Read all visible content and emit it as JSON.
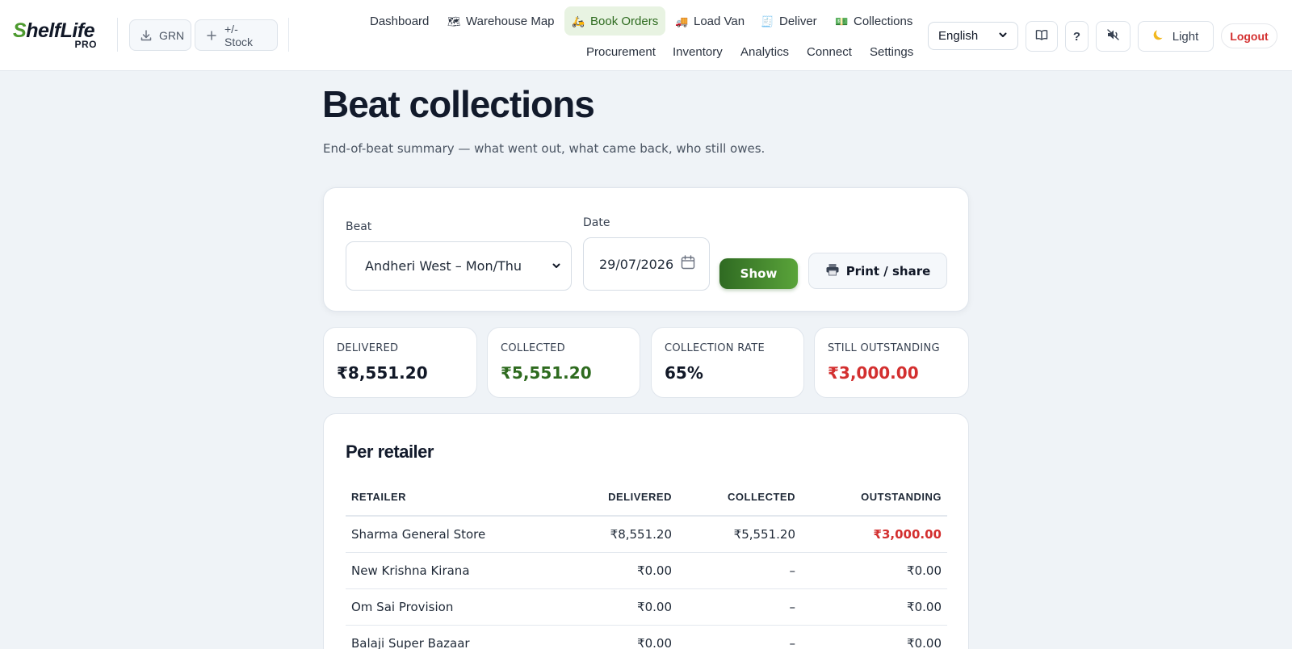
{
  "header": {
    "logo": {
      "brand_text": "ShelfLife",
      "brand_initial": "S",
      "brand_rest": "helfLife",
      "tagline": "PRO"
    },
    "quick_actions": [
      {
        "label": "GRN",
        "icon": "download-icon"
      },
      {
        "label": "+/- Stock",
        "icon": "plus-icon"
      }
    ],
    "nav_primary": [
      {
        "label": "Dashboard",
        "icon": ""
      },
      {
        "label": "Warehouse Map",
        "icon": "🗺"
      },
      {
        "label": "Book Orders",
        "icon": "🛵",
        "active": true
      },
      {
        "label": "Load Van",
        "icon": "🚚"
      },
      {
        "label": "Deliver",
        "icon": "🧾"
      },
      {
        "label": "Collections",
        "icon": "💵"
      }
    ],
    "nav_secondary": [
      {
        "label": "Procurement"
      },
      {
        "label": "Inventory"
      },
      {
        "label": "Analytics"
      },
      {
        "label": "Connect"
      },
      {
        "label": "Settings"
      }
    ],
    "language": {
      "selected": "English"
    },
    "help_label": "?",
    "theme_label": "Light",
    "logout_label": "Logout"
  },
  "page": {
    "title": "Beat collections",
    "subtitle": "End-of-beat summary — what went out, what came back, who still owes."
  },
  "filters": {
    "beat_label": "Beat",
    "beat_value": "Andheri West – Mon/Thu",
    "date_label": "Date",
    "date_value": "29/07/2026",
    "show_label": "Show",
    "print_label": "Print / share"
  },
  "stats": [
    {
      "label": "DELIVERED",
      "value": "₹8,551.20",
      "tone": "default"
    },
    {
      "label": "COLLECTED",
      "value": "₹5,551.20",
      "tone": "green"
    },
    {
      "label": "COLLECTION RATE",
      "value": "65%",
      "tone": "default"
    },
    {
      "label": "STILL OUTSTANDING",
      "value": "₹3,000.00",
      "tone": "red"
    }
  ],
  "table": {
    "title": "Per retailer",
    "columns": [
      "RETAILER",
      "DELIVERED",
      "COLLECTED",
      "OUTSTANDING"
    ],
    "rows": [
      {
        "retailer": "Sharma General Store",
        "delivered": "₹8,551.20",
        "collected": "₹5,551.20",
        "outstanding": "₹3,000.00",
        "owes": true
      },
      {
        "retailer": "New Krishna Kirana",
        "delivered": "₹0.00",
        "collected": "–",
        "outstanding": "₹0.00",
        "owes": false
      },
      {
        "retailer": "Om Sai Provision",
        "delivered": "₹0.00",
        "collected": "–",
        "outstanding": "₹0.00",
        "owes": false
      },
      {
        "retailer": "Balaji Super Bazaar",
        "delivered": "₹0.00",
        "collected": "–",
        "outstanding": "₹0.00",
        "owes": false
      }
    ]
  }
}
